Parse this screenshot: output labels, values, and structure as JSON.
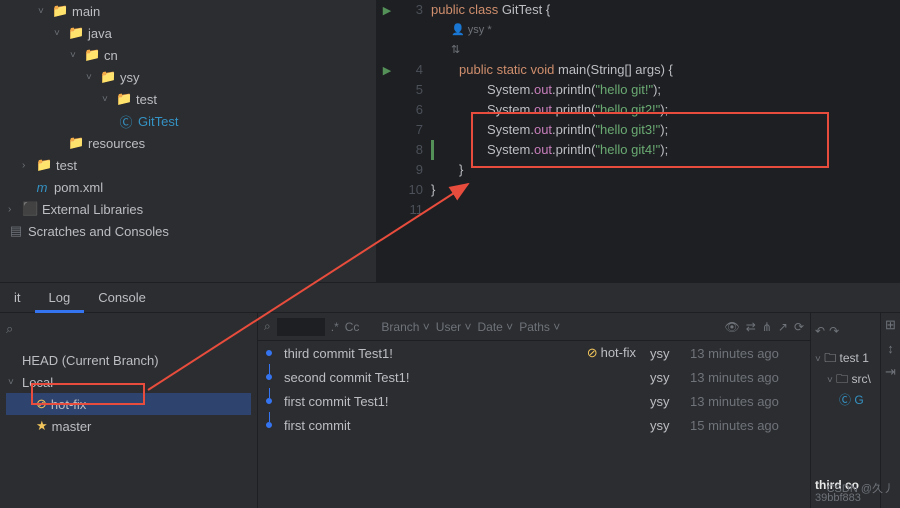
{
  "tree": {
    "main": "main",
    "java": "java",
    "cn": "cn",
    "ysy": "ysy",
    "test": "test",
    "gittest": "GitTest",
    "resources": "resources",
    "test2": "test",
    "pom": "pom.xml",
    "extlib": "External Libraries",
    "scratches": "Scratches and Consoles"
  },
  "code": {
    "line3": {
      "n": "3",
      "kw": "public class",
      "cls": " GitTest {"
    },
    "author": {
      "icon": "👤",
      "name": "ysy *"
    },
    "line4": {
      "n": "4",
      "kw": "public static void",
      "mth": " main",
      "sig": "(String[] args) {"
    },
    "line5": {
      "n": "5",
      "pre": "System.",
      "fld": "out",
      "mid": ".println(",
      "str": "\"hello git!\"",
      "post": ");"
    },
    "line6": {
      "n": "6",
      "pre": "System.",
      "fld": "out",
      "mid": ".println(",
      "str": "\"hello git2!\"",
      "post": ");"
    },
    "line7": {
      "n": "7",
      "pre": "System.",
      "fld": "out",
      "mid": ".println(",
      "str": "\"hello git3!\"",
      "post": ");"
    },
    "line8": {
      "n": "8",
      "pre": "System.",
      "fld": "out",
      "mid": ".println(",
      "str": "\"hello git4!\"",
      "post": ");"
    },
    "line9": {
      "n": "9",
      "txt": "}"
    },
    "line10": {
      "n": "10",
      "txt": "}"
    },
    "line11": {
      "n": "11"
    }
  },
  "tabs": {
    "t1": "it",
    "log": "Log",
    "console": "Console"
  },
  "branches": {
    "head": "HEAD (Current Branch)",
    "local": "Local",
    "hotfix": "hot-fix",
    "master": "master"
  },
  "filters": {
    "regex": ".*",
    "cc": "Cc",
    "branch": "Branch",
    "user": "User",
    "date": "Date",
    "paths": "Paths"
  },
  "commits": [
    {
      "msg": "third commit  Test1!",
      "tag": "hot-fix",
      "auth": "ysy",
      "time": "13 minutes ago"
    },
    {
      "msg": "second commit  Test1!",
      "tag": "",
      "auth": "ysy",
      "time": "13 minutes ago"
    },
    {
      "msg": "first commit  Test1!",
      "tag": "",
      "auth": "ysy",
      "time": "13 minutes ago"
    },
    {
      "msg": "first commit",
      "tag": "",
      "auth": "ysy",
      "time": "15 minutes ago"
    }
  ],
  "right": {
    "test": "test",
    "src": "src\\",
    "commit_title": "third co",
    "hash": "39bbf883"
  },
  "watermark": "CSDN @久丿"
}
